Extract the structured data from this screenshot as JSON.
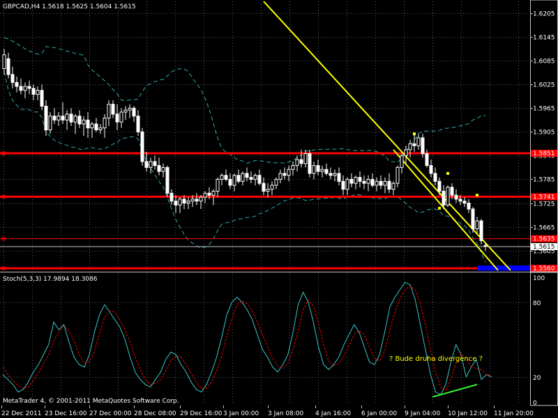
{
  "header": {
    "symbol_line": "GBPCAD,H4  1.5618 1.5625 1.5604 1.5615"
  },
  "oscillator": {
    "title": "Stoch(5,3,3) 17.9894 18.3086",
    "annotation": "? Bude druha divergence ?",
    "levels": [
      "100",
      "80",
      "20",
      "0"
    ]
  },
  "footer": {
    "copyright": "MetaTrader 4, © 2001-2011 MetaQuotes Software Corp."
  },
  "colors": {
    "background": "#000000",
    "grid": "#5a5a5a",
    "bull_candle": "#ffffff",
    "bear_candle": "#ffffff",
    "channel": "#ffff00",
    "horizontal_levels": "#ff0000",
    "bands": "#3cc8c8",
    "stoch_main": "#3cc8c8",
    "stoch_signal": "#ff0000",
    "divergence_line": "#33ff33",
    "target_box": "#0000ff",
    "annotation_text": "#ffff00"
  },
  "chart_data": [
    {
      "type": "candlestick",
      "title": "GBPCAD,H4",
      "price_axis_labels": [
        "1.6205",
        "1.6145",
        "1.6085",
        "1.6025",
        "1.5965",
        "1.5905",
        "1.5845",
        "1.5785",
        "1.5725",
        "1.5665",
        "1.5605"
      ],
      "ylim": [
        1.5555,
        1.6235
      ],
      "time_labels": [
        "22 Dec 2011",
        "23 Dec 16:00",
        "27 Dec 00:00",
        "28 Dec 08:00",
        "29 Dec 16:00",
        "3 Jan 00:00",
        "3 Jan 08:00",
        "4 Jan 16:00",
        "6 Jan 00:00",
        "9 Jan 04:00",
        "10 Jan 12:00",
        "11 Jan 20:00"
      ],
      "current_price": "1.5615",
      "horizontal_levels": [
        {
          "label": "1.5851",
          "value": 1.5851,
          "style": "thick"
        },
        {
          "label": "1.5741",
          "value": 1.5741,
          "style": "thick"
        },
        {
          "label": "1.5635",
          "value": 1.5635,
          "style": "thin"
        },
        {
          "label": "1.5560",
          "value": 1.556,
          "style": "thick"
        }
      ],
      "candles": [
        {
          "o": 1.6065,
          "h": 1.6115,
          "l": 1.605,
          "c": 1.61
        },
        {
          "o": 1.609,
          "h": 1.6105,
          "l": 1.604,
          "c": 1.605
        },
        {
          "o": 1.605,
          "h": 1.607,
          "l": 1.6015,
          "c": 1.603
        },
        {
          "o": 1.603,
          "h": 1.6045,
          "l": 1.6005,
          "c": 1.602
        },
        {
          "o": 1.602,
          "h": 1.604,
          "l": 1.6,
          "c": 1.601
        },
        {
          "o": 1.601,
          "h": 1.603,
          "l": 1.599,
          "c": 1.602
        },
        {
          "o": 1.602,
          "h": 1.6035,
          "l": 1.6,
          "c": 1.6015
        },
        {
          "o": 1.6015,
          "h": 1.6025,
          "l": 1.5985,
          "c": 1.6
        },
        {
          "o": 1.6,
          "h": 1.602,
          "l": 1.5985,
          "c": 1.601
        },
        {
          "o": 1.601,
          "h": 1.6025,
          "l": 1.596,
          "c": 1.597
        },
        {
          "o": 1.597,
          "h": 1.5985,
          "l": 1.5895,
          "c": 1.591
        },
        {
          "o": 1.591,
          "h": 1.5955,
          "l": 1.59,
          "c": 1.5945
        },
        {
          "o": 1.5945,
          "h": 1.5965,
          "l": 1.5925,
          "c": 1.5935
        },
        {
          "o": 1.5935,
          "h": 1.5955,
          "l": 1.592,
          "c": 1.5945
        },
        {
          "o": 1.5945,
          "h": 1.598,
          "l": 1.5925,
          "c": 1.5935
        },
        {
          "o": 1.5935,
          "h": 1.596,
          "l": 1.591,
          "c": 1.595
        },
        {
          "o": 1.595,
          "h": 1.5965,
          "l": 1.592,
          "c": 1.593
        },
        {
          "o": 1.593,
          "h": 1.595,
          "l": 1.59,
          "c": 1.5945
        },
        {
          "o": 1.5945,
          "h": 1.596,
          "l": 1.5915,
          "c": 1.5925
        },
        {
          "o": 1.5925,
          "h": 1.5945,
          "l": 1.5895,
          "c": 1.5935
        },
        {
          "o": 1.5935,
          "h": 1.5955,
          "l": 1.589,
          "c": 1.5915
        },
        {
          "o": 1.5915,
          "h": 1.593,
          "l": 1.589,
          "c": 1.5925
        },
        {
          "o": 1.5925,
          "h": 1.594,
          "l": 1.5905,
          "c": 1.591
        },
        {
          "o": 1.591,
          "h": 1.5925,
          "l": 1.59,
          "c": 1.5915
        },
        {
          "o": 1.5915,
          "h": 1.595,
          "l": 1.589,
          "c": 1.594
        },
        {
          "o": 1.594,
          "h": 1.5985,
          "l": 1.592,
          "c": 1.5975
        },
        {
          "o": 1.5975,
          "h": 1.5985,
          "l": 1.594,
          "c": 1.595
        },
        {
          "o": 1.595,
          "h": 1.5975,
          "l": 1.591,
          "c": 1.593
        },
        {
          "o": 1.593,
          "h": 1.5965,
          "l": 1.5915,
          "c": 1.5955
        },
        {
          "o": 1.5955,
          "h": 1.597,
          "l": 1.5935,
          "c": 1.596
        },
        {
          "o": 1.596,
          "h": 1.5975,
          "l": 1.594,
          "c": 1.5965
        },
        {
          "o": 1.5965,
          "h": 1.597,
          "l": 1.593,
          "c": 1.5945
        },
        {
          "o": 1.5945,
          "h": 1.596,
          "l": 1.5895,
          "c": 1.5905
        },
        {
          "o": 1.5905,
          "h": 1.5915,
          "l": 1.582,
          "c": 1.583
        },
        {
          "o": 1.583,
          "h": 1.5855,
          "l": 1.5805,
          "c": 1.5815
        },
        {
          "o": 1.5815,
          "h": 1.584,
          "l": 1.58,
          "c": 1.583
        },
        {
          "o": 1.583,
          "h": 1.5845,
          "l": 1.581,
          "c": 1.582
        },
        {
          "o": 1.582,
          "h": 1.584,
          "l": 1.5795,
          "c": 1.5805
        },
        {
          "o": 1.5805,
          "h": 1.5825,
          "l": 1.579,
          "c": 1.5815
        },
        {
          "o": 1.5815,
          "h": 1.582,
          "l": 1.574,
          "c": 1.575
        },
        {
          "o": 1.575,
          "h": 1.576,
          "l": 1.572,
          "c": 1.573
        },
        {
          "o": 1.573,
          "h": 1.5745,
          "l": 1.57,
          "c": 1.572
        },
        {
          "o": 1.572,
          "h": 1.574,
          "l": 1.57,
          "c": 1.5735
        },
        {
          "o": 1.5735,
          "h": 1.5745,
          "l": 1.571,
          "c": 1.5725
        },
        {
          "o": 1.5725,
          "h": 1.574,
          "l": 1.571,
          "c": 1.573
        },
        {
          "o": 1.573,
          "h": 1.5745,
          "l": 1.5715,
          "c": 1.5735
        },
        {
          "o": 1.5735,
          "h": 1.575,
          "l": 1.572,
          "c": 1.573
        },
        {
          "o": 1.573,
          "h": 1.5745,
          "l": 1.571,
          "c": 1.574
        },
        {
          "o": 1.574,
          "h": 1.5755,
          "l": 1.5725,
          "c": 1.575
        },
        {
          "o": 1.575,
          "h": 1.5765,
          "l": 1.5735,
          "c": 1.5745
        },
        {
          "o": 1.5745,
          "h": 1.576,
          "l": 1.572,
          "c": 1.5755
        },
        {
          "o": 1.5755,
          "h": 1.579,
          "l": 1.574,
          "c": 1.5785
        },
        {
          "o": 1.5785,
          "h": 1.58,
          "l": 1.577,
          "c": 1.5795
        },
        {
          "o": 1.5795,
          "h": 1.581,
          "l": 1.578,
          "c": 1.5785
        },
        {
          "o": 1.5785,
          "h": 1.58,
          "l": 1.576,
          "c": 1.577
        },
        {
          "o": 1.577,
          "h": 1.58,
          "l": 1.5755,
          "c": 1.5795
        },
        {
          "o": 1.5795,
          "h": 1.581,
          "l": 1.5775,
          "c": 1.578
        },
        {
          "o": 1.578,
          "h": 1.5805,
          "l": 1.577,
          "c": 1.58
        },
        {
          "o": 1.58,
          "h": 1.5815,
          "l": 1.578,
          "c": 1.579
        },
        {
          "o": 1.579,
          "h": 1.5805,
          "l": 1.5775,
          "c": 1.5785
        },
        {
          "o": 1.5785,
          "h": 1.58,
          "l": 1.577,
          "c": 1.5795
        },
        {
          "o": 1.5795,
          "h": 1.581,
          "l": 1.577,
          "c": 1.5775
        },
        {
          "o": 1.5775,
          "h": 1.579,
          "l": 1.5745,
          "c": 1.5755
        },
        {
          "o": 1.5755,
          "h": 1.5775,
          "l": 1.574,
          "c": 1.576
        },
        {
          "o": 1.576,
          "h": 1.578,
          "l": 1.5745,
          "c": 1.577
        },
        {
          "o": 1.577,
          "h": 1.579,
          "l": 1.576,
          "c": 1.5785
        },
        {
          "o": 1.5785,
          "h": 1.581,
          "l": 1.5775,
          "c": 1.58
        },
        {
          "o": 1.58,
          "h": 1.5815,
          "l": 1.5785,
          "c": 1.5795
        },
        {
          "o": 1.5795,
          "h": 1.582,
          "l": 1.578,
          "c": 1.581
        },
        {
          "o": 1.581,
          "h": 1.583,
          "l": 1.5795,
          "c": 1.582
        },
        {
          "o": 1.582,
          "h": 1.5845,
          "l": 1.5805,
          "c": 1.5835
        },
        {
          "o": 1.5835,
          "h": 1.586,
          "l": 1.5815,
          "c": 1.5825
        },
        {
          "o": 1.5825,
          "h": 1.586,
          "l": 1.5815,
          "c": 1.585
        },
        {
          "o": 1.585,
          "h": 1.586,
          "l": 1.579,
          "c": 1.58
        },
        {
          "o": 1.58,
          "h": 1.583,
          "l": 1.5785,
          "c": 1.582
        },
        {
          "o": 1.582,
          "h": 1.5835,
          "l": 1.5795,
          "c": 1.5805
        },
        {
          "o": 1.5805,
          "h": 1.582,
          "l": 1.579,
          "c": 1.581
        },
        {
          "o": 1.581,
          "h": 1.5825,
          "l": 1.5795,
          "c": 1.58
        },
        {
          "o": 1.58,
          "h": 1.5815,
          "l": 1.5785,
          "c": 1.5795
        },
        {
          "o": 1.5795,
          "h": 1.581,
          "l": 1.578,
          "c": 1.58
        },
        {
          "o": 1.58,
          "h": 1.5815,
          "l": 1.577,
          "c": 1.578
        },
        {
          "o": 1.578,
          "h": 1.5795,
          "l": 1.5745,
          "c": 1.576
        },
        {
          "o": 1.576,
          "h": 1.579,
          "l": 1.5745,
          "c": 1.5785
        },
        {
          "o": 1.5785,
          "h": 1.58,
          "l": 1.5765,
          "c": 1.5775
        },
        {
          "o": 1.5775,
          "h": 1.5795,
          "l": 1.576,
          "c": 1.579
        },
        {
          "o": 1.579,
          "h": 1.5805,
          "l": 1.5765,
          "c": 1.578
        },
        {
          "o": 1.578,
          "h": 1.5795,
          "l": 1.576,
          "c": 1.5775
        },
        {
          "o": 1.5775,
          "h": 1.5795,
          "l": 1.5755,
          "c": 1.5785
        },
        {
          "o": 1.5785,
          "h": 1.58,
          "l": 1.5765,
          "c": 1.577
        },
        {
          "o": 1.577,
          "h": 1.579,
          "l": 1.5755,
          "c": 1.578
        },
        {
          "o": 1.578,
          "h": 1.5795,
          "l": 1.576,
          "c": 1.577
        },
        {
          "o": 1.577,
          "h": 1.579,
          "l": 1.575,
          "c": 1.578
        },
        {
          "o": 1.578,
          "h": 1.58,
          "l": 1.575,
          "c": 1.576
        },
        {
          "o": 1.576,
          "h": 1.578,
          "l": 1.5745,
          "c": 1.5775
        },
        {
          "o": 1.5775,
          "h": 1.582,
          "l": 1.5765,
          "c": 1.5815
        },
        {
          "o": 1.5815,
          "h": 1.585,
          "l": 1.58,
          "c": 1.5845
        },
        {
          "o": 1.5845,
          "h": 1.587,
          "l": 1.5825,
          "c": 1.586
        },
        {
          "o": 1.586,
          "h": 1.5885,
          "l": 1.584,
          "c": 1.5875
        },
        {
          "o": 1.5875,
          "h": 1.59,
          "l": 1.5855,
          "c": 1.587
        },
        {
          "o": 1.587,
          "h": 1.59,
          "l": 1.586,
          "c": 1.589
        },
        {
          "o": 1.589,
          "h": 1.59,
          "l": 1.584,
          "c": 1.585
        },
        {
          "o": 1.585,
          "h": 1.586,
          "l": 1.5815,
          "c": 1.582
        },
        {
          "o": 1.582,
          "h": 1.5835,
          "l": 1.579,
          "c": 1.58
        },
        {
          "o": 1.58,
          "h": 1.5815,
          "l": 1.577,
          "c": 1.578
        },
        {
          "o": 1.578,
          "h": 1.579,
          "l": 1.5745,
          "c": 1.5755
        },
        {
          "o": 1.5755,
          "h": 1.577,
          "l": 1.571,
          "c": 1.572
        },
        {
          "o": 1.572,
          "h": 1.577,
          "l": 1.5715,
          "c": 1.5765
        },
        {
          "o": 1.5765,
          "h": 1.5775,
          "l": 1.5735,
          "c": 1.5745
        },
        {
          "o": 1.5745,
          "h": 1.576,
          "l": 1.5725,
          "c": 1.5735
        },
        {
          "o": 1.5735,
          "h": 1.5745,
          "l": 1.572,
          "c": 1.573
        },
        {
          "o": 1.573,
          "h": 1.574,
          "l": 1.5715,
          "c": 1.5725
        },
        {
          "o": 1.5725,
          "h": 1.5735,
          "l": 1.57,
          "c": 1.571
        },
        {
          "o": 1.571,
          "h": 1.5715,
          "l": 1.565,
          "c": 1.566
        },
        {
          "o": 1.566,
          "h": 1.569,
          "l": 1.565,
          "c": 1.568
        },
        {
          "o": 1.568,
          "h": 1.5685,
          "l": 1.562,
          "c": 1.563
        },
        {
          "o": 1.5618,
          "h": 1.5625,
          "l": 1.5604,
          "c": 1.5615
        }
      ]
    },
    {
      "type": "line",
      "title": "Stoch(5,3,3) 17.9894 18.3086",
      "ylim": [
        0,
        100
      ],
      "levels": [
        20,
        80
      ],
      "series": [
        {
          "values": [
            22,
            18,
            14,
            8,
            10,
            16,
            24,
            30,
            38,
            46,
            64,
            58,
            62,
            48,
            36,
            30,
            28,
            38,
            56,
            70,
            78,
            72,
            66,
            60,
            50,
            36,
            24,
            18,
            14,
            12,
            18,
            24,
            34,
            40,
            38,
            30,
            24,
            16,
            10,
            8,
            14,
            24,
            36,
            52,
            70,
            80,
            84,
            80,
            74,
            66,
            54,
            42,
            36,
            28,
            24,
            30,
            38,
            56,
            78,
            88,
            80,
            64,
            44,
            30,
            26,
            30,
            36,
            46,
            54,
            62,
            56,
            44,
            32,
            30,
            38,
            56,
            76,
            84,
            90,
            96,
            94,
            82,
            62,
            42,
            22,
            8,
            6,
            14,
            32,
            46,
            38,
            20,
            28,
            34,
            18,
            22,
            20
          ]
        },
        {
          "values": [
            28,
            22,
            17,
            13,
            11,
            12,
            17,
            23,
            31,
            38,
            49,
            56,
            61,
            57,
            49,
            38,
            31,
            32,
            41,
            55,
            68,
            73,
            72,
            66,
            58,
            48,
            36,
            26,
            18,
            14,
            15,
            18,
            25,
            33,
            37,
            36,
            30,
            23,
            16,
            11,
            11,
            16,
            25,
            37,
            53,
            67,
            78,
            81,
            79,
            73,
            64,
            54,
            44,
            35,
            29,
            27,
            31,
            42,
            57,
            74,
            82,
            77,
            63,
            46,
            33,
            29,
            31,
            37,
            45,
            54,
            57,
            54,
            44,
            35,
            33,
            41,
            57,
            72,
            83,
            90,
            93,
            90,
            79,
            62,
            42,
            24,
            12,
            9,
            18,
            31,
            39,
            35,
            28,
            27,
            26,
            22,
            21
          ]
        }
      ]
    }
  ]
}
